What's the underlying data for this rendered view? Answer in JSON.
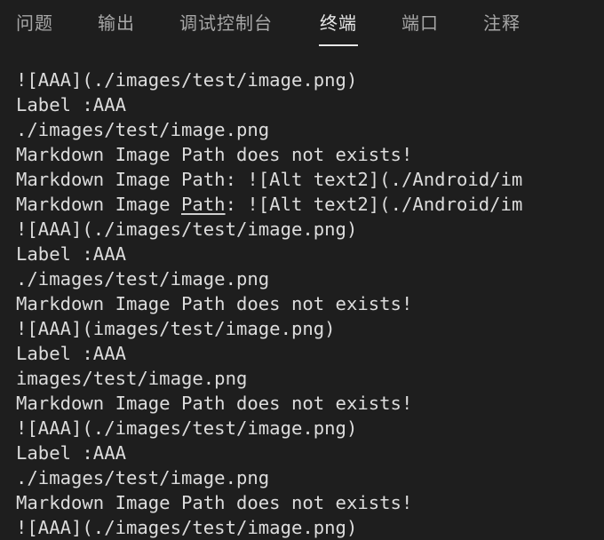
{
  "tabs": [
    {
      "label": "问题",
      "active": false
    },
    {
      "label": "输出",
      "active": false
    },
    {
      "label": "调试控制台",
      "active": false
    },
    {
      "label": "终端",
      "active": true
    },
    {
      "label": "端口",
      "active": false
    },
    {
      "label": "注释",
      "active": false
    }
  ],
  "terminal": {
    "lines": [
      "![AAA](./images/test/image.png)",
      "Label :AAA",
      "./images/test/image.png",
      "Markdown Image Path does not exists!",
      "Markdown Image Path: ![Alt text2](./Android/im",
      {
        "before": "Markdown Image ",
        "link": "Path",
        "after": ": ![Alt text2](./Android/im"
      },
      "![AAA](./images/test/image.png)",
      "Label :AAA",
      "./images/test/image.png",
      "Markdown Image Path does not exists!",
      "![AAA](images/test/image.png)",
      "Label :AAA",
      "images/test/image.png",
      "Markdown Image Path does not exists!",
      "![AAA](./images/test/image.png)",
      "Label :AAA",
      "./images/test/image.png",
      "Markdown Image Path does not exists!",
      "![AAA](./images/test/image.png)"
    ]
  }
}
